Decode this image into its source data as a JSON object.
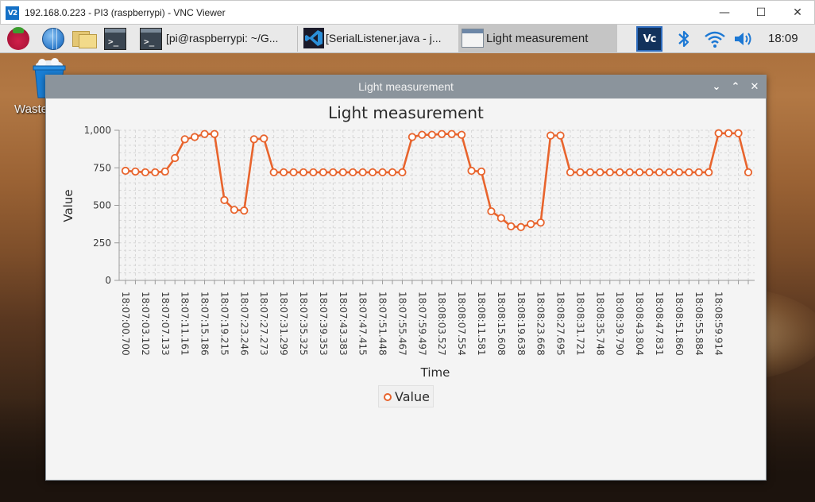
{
  "vnc": {
    "logo_text": "V2",
    "title": "192.168.0.223 - PI3 (raspberrypi) - VNC Viewer"
  },
  "taskbar": {
    "terminal_task_label": "[pi@raspberrypi: ~/G...",
    "vscode_task_label": "[SerialListener.java - j...",
    "light_task_label": "Light measurement",
    "vnc_tray_text": "Vc",
    "clock": "18:09"
  },
  "desktop": {
    "trash_label": "Waste"
  },
  "app": {
    "title": "Light measurement"
  },
  "colors": {
    "series": "#e8642d",
    "titlebar": "#8b949c",
    "plot_bg": "#f4f4f4"
  },
  "chart_data": {
    "type": "line",
    "title": "Light measurement",
    "xlabel": "Time",
    "ylabel": "Value",
    "ylim": [
      0,
      1000
    ],
    "yticks": [
      0,
      250,
      500,
      750,
      1000
    ],
    "ytick_labels": [
      "0",
      "250",
      "500",
      "750",
      "1,000"
    ],
    "xtick_labels": [
      "18:07:00.700",
      "18:07:03.102",
      "18:07:07.133",
      "18:07:11.161",
      "18:07:15.186",
      "18:07:19.215",
      "18:07:23.246",
      "18:07:27.273",
      "18:07:31.299",
      "18:07:35.325",
      "18:07:39.353",
      "18:07:43.383",
      "18:07:47.415",
      "18:07:51.448",
      "18:07:55.467",
      "18:07:59.497",
      "18:08:03.527",
      "18:08:07.554",
      "18:08:11.581",
      "18:08:15.608",
      "18:08:19.638",
      "18:08:23.668",
      "18:08:27.695",
      "18:08:31.721",
      "18:08:35.748",
      "18:08:39.790",
      "18:08:43.804",
      "18:08:47.831",
      "18:08:51.860",
      "18:08:55.884",
      "18:08:59.914"
    ],
    "grid": true,
    "legend_position": "bottom",
    "series": [
      {
        "name": "Value",
        "values": [
          730,
          725,
          720,
          720,
          725,
          815,
          940,
          955,
          975,
          975,
          535,
          470,
          465,
          940,
          945,
          720,
          720,
          720,
          720,
          720,
          720,
          720,
          720,
          720,
          720,
          720,
          720,
          720,
          720,
          955,
          970,
          970,
          975,
          975,
          970,
          730,
          725,
          460,
          415,
          360,
          355,
          375,
          385,
          965,
          965,
          720,
          720,
          720,
          720,
          720,
          720,
          720,
          720,
          720,
          720,
          720,
          720,
          720,
          720,
          720,
          980,
          980,
          980,
          720
        ]
      }
    ]
  }
}
